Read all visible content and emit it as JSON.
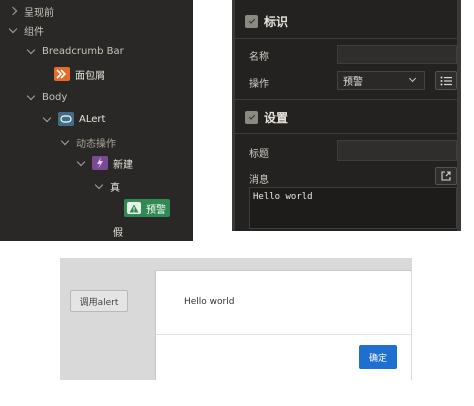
{
  "tree": {
    "nodes": [
      {
        "label": "呈现前",
        "icon": null
      },
      {
        "label": "组件",
        "icon": null
      },
      {
        "label": "Breadcrumb Bar",
        "icon": null
      },
      {
        "label": "面包屑",
        "icon": "breadcrumb-icon"
      },
      {
        "label": "Body",
        "icon": null
      },
      {
        "label": "ALert",
        "icon": "alert-icon"
      },
      {
        "label": "动态操作",
        "icon": null
      },
      {
        "label": "新建",
        "icon": "lightning-icon"
      },
      {
        "label": "真",
        "icon": null
      },
      {
        "label": "预警",
        "icon": "warning-icon",
        "selected": true
      },
      {
        "label": "假",
        "icon": null
      }
    ]
  },
  "props": {
    "section1": {
      "title": "标识"
    },
    "name_label": "名称",
    "name_value": "",
    "action_label": "操作",
    "action_value": "预警",
    "section2": {
      "title": "设置"
    },
    "title_label": "标题",
    "title_value": "",
    "message_label": "消息",
    "message_value": "Hello world"
  },
  "preview": {
    "call_button": "调用alert",
    "dialog_message": "Hello world",
    "ok_button": "确定"
  },
  "colors": {
    "tree_bg": "#2a2826",
    "panel_bg": "#232221",
    "selected_node": "#2f8a53",
    "ok_button": "#1f6fd0"
  }
}
